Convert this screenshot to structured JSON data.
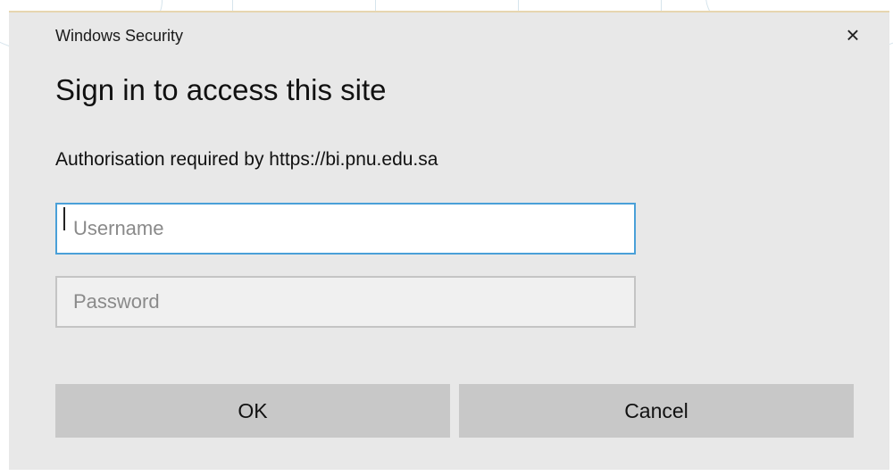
{
  "dialog": {
    "window_title": "Windows Security",
    "close_symbol": "×",
    "heading": "Sign in to access this site",
    "auth_message": "Authorisation required by https://bi.pnu.edu.sa",
    "username": {
      "value": "",
      "placeholder": "Username"
    },
    "password": {
      "value": "",
      "placeholder": "Password"
    },
    "ok_label": "OK",
    "cancel_label": "Cancel"
  },
  "icons": {
    "close": "close-icon"
  },
  "colors": {
    "dialog_background": "#e8e8e8",
    "focus_border": "#4aa0d8",
    "button_background": "#c8c8c8"
  }
}
